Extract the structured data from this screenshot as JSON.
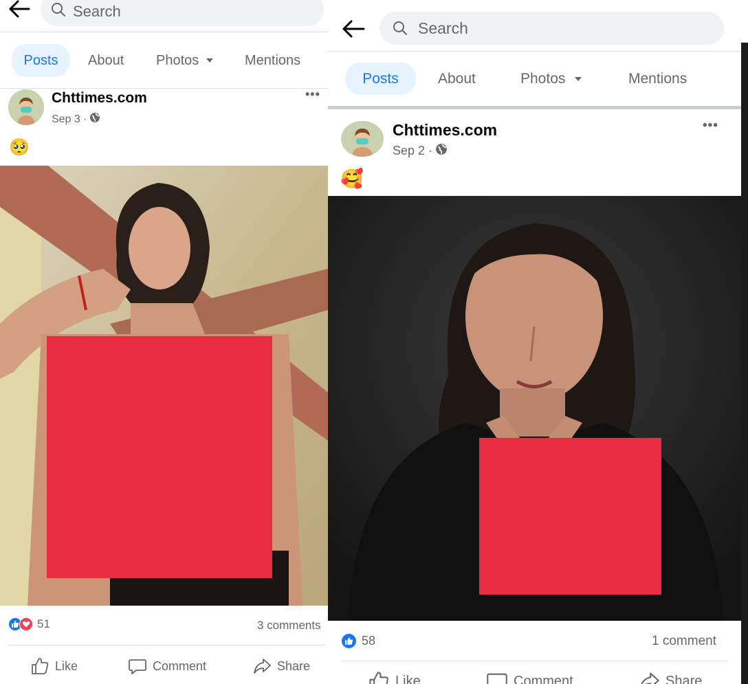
{
  "search": {
    "placeholder": "Search"
  },
  "tabs": [
    {
      "label": "Posts",
      "active": true
    },
    {
      "label": "About",
      "active": false
    },
    {
      "label": "Photos",
      "active": false,
      "has_dropdown": true
    },
    {
      "label": "Mentions",
      "active": false
    }
  ],
  "posts": [
    {
      "author": "Chttimes.com",
      "date": "Sep 3",
      "separator": "·",
      "emoji": "🥺",
      "reactions": {
        "icons": [
          "like",
          "love"
        ],
        "count": "51"
      },
      "comments": "3 comments",
      "actions": [
        "Like",
        "Comment",
        "Share"
      ]
    },
    {
      "author": "Chttimes.com",
      "date": "Sep 2",
      "separator": "·",
      "emoji": "🥰",
      "reactions": {
        "icons": [
          "like"
        ],
        "count": "58"
      },
      "comments": "1 comment",
      "actions": [
        "Like",
        "Comment",
        "Share"
      ]
    }
  ],
  "colors": {
    "accent": "#1877f2",
    "tab_active_bg": "#e7f3ff",
    "censor": "#e82c41",
    "love": "#f33e58",
    "muted": "#65676b"
  }
}
